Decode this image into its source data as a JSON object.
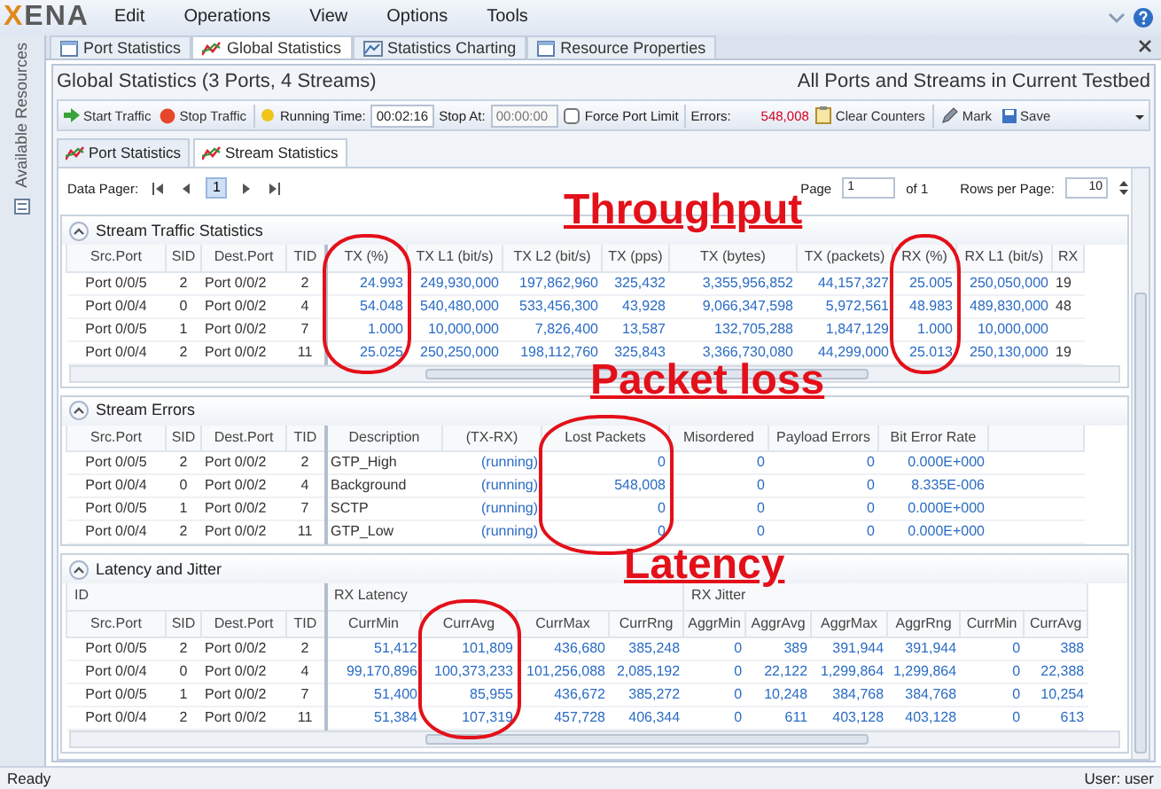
{
  "menu": {
    "logo": "XENA",
    "items": [
      "Edit",
      "Operations",
      "View",
      "Options",
      "Tools"
    ]
  },
  "sidebar": {
    "label": "Available Resources"
  },
  "doc_tabs": [
    {
      "label": "Port Statistics",
      "selected": false
    },
    {
      "label": "Global Statistics",
      "selected": true
    },
    {
      "label": "Statistics Charting",
      "selected": false
    },
    {
      "label": "Resource Properties",
      "selected": false
    }
  ],
  "panel": {
    "title": "Global Statistics (3 Ports, 4 Streams)",
    "scope": "All Ports and Streams in Current Testbed"
  },
  "toolbar": {
    "start": "Start Traffic",
    "stop": "Stop Traffic",
    "running_label": "Running Time:",
    "running_time": "00:02:16",
    "stop_at_label": "Stop At:",
    "stop_at_placeholder": "00:00:00",
    "force_port_limit": {
      "label": "Force Port Limit",
      "checked": false
    },
    "errors_label": "Errors:",
    "errors": "548,008",
    "clear": "Clear Counters",
    "mark": "Mark",
    "save": "Save"
  },
  "sub_tabs": [
    {
      "label": "Port Statistics",
      "selected": false
    },
    {
      "label": "Stream Statistics",
      "selected": true
    }
  ],
  "pager": {
    "label": "Data Pager:",
    "pages": [
      {
        "label": "1",
        "selected": true
      }
    ],
    "page_label": "Page",
    "page": "1",
    "of": "of 1",
    "rows_label": "Rows per Page:",
    "rows": "10"
  },
  "sections": [
    {
      "title": "Stream Traffic Statistics",
      "expanded": true,
      "scrollbar": true,
      "columns": [
        {
          "label": "Src.Port",
          "kind": "center"
        },
        {
          "label": "SID",
          "kind": "center"
        },
        {
          "label": "Dest.Port",
          "kind": "left"
        },
        {
          "label": "TID",
          "kind": "center"
        },
        {
          "label": "TX (%)",
          "kind": "number"
        },
        {
          "label": "TX L1 (bit/s)",
          "kind": "number"
        },
        {
          "label": "TX L2 (bit/s)",
          "kind": "number"
        },
        {
          "label": "TX (pps)",
          "kind": "number"
        },
        {
          "label": "TX (bytes)",
          "kind": "number"
        },
        {
          "label": "TX (packets)",
          "kind": "number"
        },
        {
          "label": "RX (%)",
          "kind": "number"
        },
        {
          "label": "RX L1 (bit/s)",
          "kind": "number"
        },
        {
          "label": "RX",
          "kind": "left"
        }
      ],
      "rows": [
        [
          "Port 0/0/5",
          "2",
          "Port 0/0/2",
          "2",
          "24.993",
          "249,930,000",
          "197,862,960",
          "325,432",
          "3,355,956,852",
          "44,157,327",
          "25.005",
          "250,050,000",
          "19"
        ],
        [
          "Port 0/0/4",
          "0",
          "Port 0/0/2",
          "4",
          "54.048",
          "540,480,000",
          "533,456,300",
          "43,928",
          "9,066,347,598",
          "5,972,561",
          "48.983",
          "489,830,000",
          "48"
        ],
        [
          "Port 0/0/5",
          "1",
          "Port 0/0/2",
          "7",
          "1.000",
          "10,000,000",
          "7,826,400",
          "13,587",
          "132,705,288",
          "1,847,129",
          "1.000",
          "10,000,000",
          ""
        ],
        [
          "Port 0/0/4",
          "2",
          "Port 0/0/2",
          "11",
          "25.025",
          "250,250,000",
          "198,112,760",
          "325,843",
          "3,366,730,080",
          "44,299,000",
          "25.013",
          "250,130,000",
          "19"
        ]
      ]
    },
    {
      "title": "Stream Errors",
      "expanded": true,
      "columns": [
        {
          "label": "Src.Port",
          "kind": "center"
        },
        {
          "label": "SID",
          "kind": "center"
        },
        {
          "label": "Dest.Port",
          "kind": "left"
        },
        {
          "label": "TID",
          "kind": "center"
        },
        {
          "label": "Description",
          "kind": "left"
        },
        {
          "label": "(TX-RX)",
          "kind": "number"
        },
        {
          "label": "Lost Packets",
          "kind": "number"
        },
        {
          "label": "Misordered",
          "kind": "number"
        },
        {
          "label": "Payload Errors",
          "kind": "number"
        },
        {
          "label": "Bit Error Rate",
          "kind": "number"
        }
      ],
      "rows": [
        [
          "Port 0/0/5",
          "2",
          "Port 0/0/2",
          "2",
          "GTP_High",
          "(running)",
          "0",
          "0",
          "0",
          "0.000E+000"
        ],
        [
          "Port 0/0/4",
          "0",
          "Port 0/0/2",
          "4",
          "Background",
          "(running)",
          "548,008",
          "0",
          "0",
          "8.335E-006"
        ],
        [
          "Port 0/0/5",
          "1",
          "Port 0/0/2",
          "7",
          "SCTP",
          "(running)",
          "0",
          "0",
          "0",
          "0.000E+000"
        ],
        [
          "Port 0/0/4",
          "2",
          "Port 0/0/2",
          "11",
          "GTP_Low",
          "(running)",
          "0",
          "0",
          "0",
          "0.000E+000"
        ]
      ]
    },
    {
      "title": "Latency and Jitter",
      "expanded": true,
      "scrollbar": true,
      "groups": [
        {
          "label": "ID",
          "columns": [
            {
              "label": "Src.Port",
              "kind": "center"
            },
            {
              "label": "SID",
              "kind": "center"
            },
            {
              "label": "Dest.Port",
              "kind": "left"
            },
            {
              "label": "TID",
              "kind": "center"
            }
          ]
        },
        {
          "label": "RX Latency",
          "columns": [
            {
              "label": "CurrMin",
              "kind": "number"
            },
            {
              "label": "CurrAvg",
              "kind": "number"
            },
            {
              "label": "CurrMax",
              "kind": "number"
            },
            {
              "label": "CurrRng",
              "kind": "number"
            }
          ]
        },
        {
          "label": "RX Jitter",
          "columns": [
            {
              "label": "AggrMin",
              "kind": "number"
            },
            {
              "label": "AggrAvg",
              "kind": "number"
            },
            {
              "label": "AggrMax",
              "kind": "number"
            },
            {
              "label": "AggrRng",
              "kind": "number"
            },
            {
              "label": "CurrMin",
              "kind": "number"
            },
            {
              "label": "CurrAvg",
              "kind": "number"
            }
          ]
        }
      ],
      "rows": [
        [
          "Port 0/0/5",
          "2",
          "Port 0/0/2",
          "2",
          "51,412",
          "101,809",
          "436,680",
          "385,248",
          "0",
          "389",
          "391,944",
          "391,944",
          "0",
          "388"
        ],
        [
          "Port 0/0/4",
          "0",
          "Port 0/0/2",
          "4",
          "99,170,896",
          "100,373,233",
          "101,256,088",
          "2,085,192",
          "0",
          "22,122",
          "1,299,864",
          "1,299,864",
          "0",
          "22,388"
        ],
        [
          "Port 0/0/5",
          "1",
          "Port 0/0/2",
          "7",
          "51,400",
          "85,955",
          "436,672",
          "385,272",
          "0",
          "10,248",
          "384,768",
          "384,768",
          "0",
          "10,254"
        ],
        [
          "Port 0/0/4",
          "2",
          "Port 0/0/2",
          "11",
          "51,384",
          "107,319",
          "457,728",
          "406,344",
          "0",
          "611",
          "403,128",
          "403,128",
          "0",
          "613"
        ]
      ]
    }
  ],
  "annotations": [
    {
      "text": "Throughput"
    },
    {
      "text": "Packet loss"
    },
    {
      "text": "Latency"
    }
  ],
  "status_bar": {
    "left": "Ready",
    "right": "User: user"
  }
}
